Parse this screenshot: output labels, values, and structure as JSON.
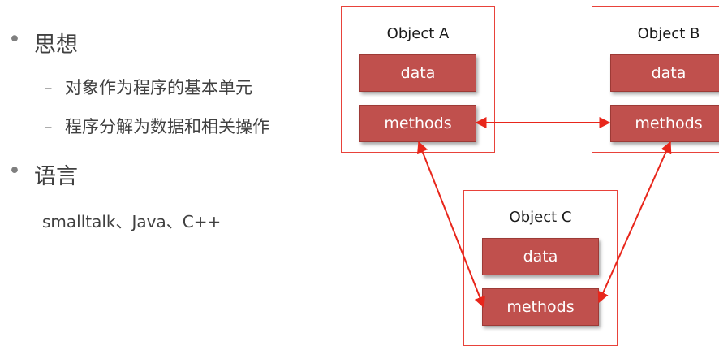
{
  "bullets": [
    {
      "text": "思想",
      "children": [
        "对象作为程序的基本单元",
        "程序分解为数据和相关操作"
      ]
    },
    {
      "text": "语言",
      "plain": "smalltalk、Java、C++"
    }
  ],
  "diagram": {
    "objects": [
      {
        "id": "a",
        "title": "Object A",
        "fields": [
          "data",
          "methods"
        ]
      },
      {
        "id": "b",
        "title": "Object B",
        "fields": [
          "data",
          "methods"
        ]
      },
      {
        "id": "c",
        "title": "Object C",
        "fields": [
          "data",
          "methods"
        ]
      }
    ],
    "connections": [
      {
        "from": "a.methods",
        "to": "b.methods"
      },
      {
        "from": "a.methods",
        "to": "c.methods"
      },
      {
        "from": "b.methods",
        "to": "c.methods"
      }
    ],
    "colors": {
      "box_border": "#e8423a",
      "field_fill": "#c0504d",
      "arrow": "#e8261b"
    }
  }
}
